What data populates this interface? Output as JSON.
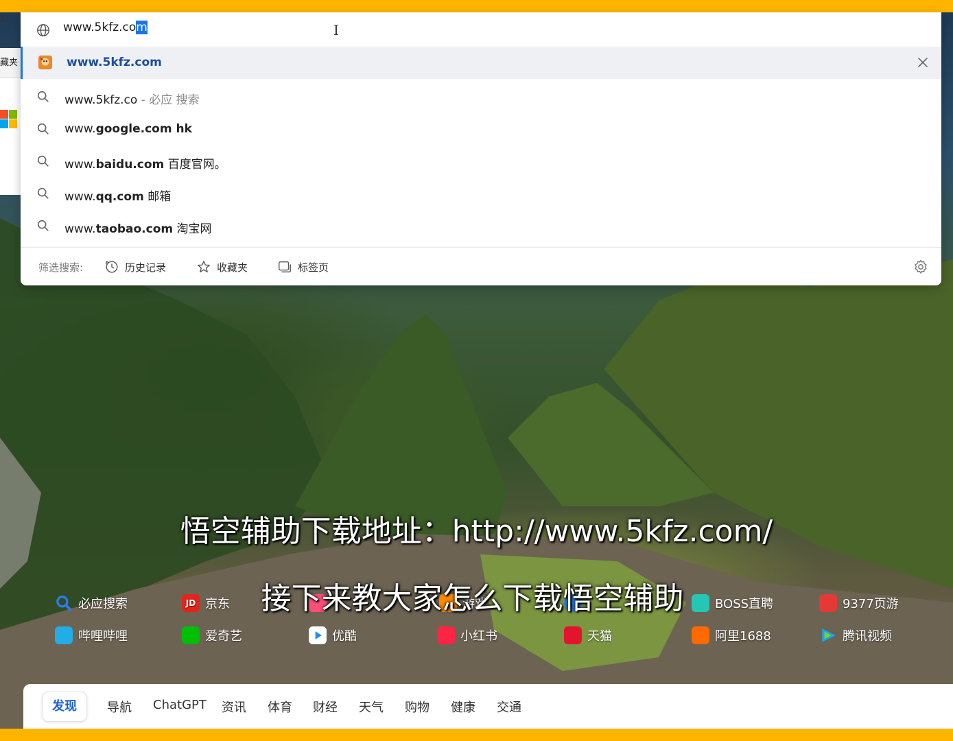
{
  "omnibox": {
    "input_value_prefix": "www.5kfz.co",
    "input_value_selected": "m"
  },
  "suggestions": [
    {
      "prefix": "",
      "bold": "www.5kfz.com",
      "suffix": "",
      "type": "site"
    },
    {
      "prefix": "www.5kfz.co",
      "bold": "",
      "suffix": " - 必应 搜索",
      "type": "search"
    },
    {
      "prefix": "www.",
      "bold": "google.com hk",
      "suffix": "",
      "type": "search"
    },
    {
      "prefix": "www.",
      "bold": "baidu.com",
      "suffix": " 百度官网。",
      "type": "search"
    },
    {
      "prefix": "www.",
      "bold": "qq.com",
      "suffix": " 邮箱",
      "type": "search"
    },
    {
      "prefix": "www.",
      "bold": "taobao.com",
      "suffix": " 淘宝网",
      "type": "search"
    }
  ],
  "filter": {
    "label": "筛选搜索:",
    "history": "历史记录",
    "favorites": "收藏夹",
    "tabs": "标签页"
  },
  "left_chrome": {
    "bookmark_label": "藏夹"
  },
  "quick_links_row1": [
    {
      "label": "必应搜索",
      "icon": "search-icon",
      "color": "#2b7bf6"
    },
    {
      "label": "京东",
      "icon": "JD",
      "color": "#e1251b"
    },
    {
      "label": "",
      "icon": "pink-app-icon",
      "color": "#ff4f7a"
    },
    {
      "label": "游戏",
      "icon": "game-icon",
      "color": "#ff8a00"
    },
    {
      "label": "",
      "icon": "blue-app-icon",
      "color": "#2f80ed"
    },
    {
      "label": "BOSS直聘",
      "icon": "boss-icon",
      "color": "#25c6b4"
    },
    {
      "label": "9377页游",
      "icon": "9377-icon",
      "color": "#e53935"
    }
  ],
  "quick_links_row2": [
    {
      "label": "哔哩哔哩",
      "icon": "bilibili-icon",
      "color": "#23ade5"
    },
    {
      "label": "爱奇艺",
      "icon": "iqiyi-icon",
      "color": "#00be06"
    },
    {
      "label": "优酷",
      "icon": "youku-icon",
      "color": "#1f8ef1"
    },
    {
      "label": "小红书",
      "icon": "xiaohongshu-icon",
      "color": "#ff2442"
    },
    {
      "label": "天猫",
      "icon": "tmall-icon",
      "color": "#e3152d"
    },
    {
      "label": "阿里1688",
      "icon": "1688-icon",
      "color": "#ff6a00"
    },
    {
      "label": "腾讯视频",
      "icon": "tencent-video-icon",
      "color": "#13a9f2"
    }
  ],
  "captions": {
    "line1": "悟空辅助下载地址：http://www.5kfz.com/",
    "line2": "接下来教大家怎么下载悟空辅助"
  },
  "feed_tabs": [
    "发现",
    "导航",
    "ChatGPT",
    "资讯",
    "体育",
    "财经",
    "天气",
    "购物",
    "健康",
    "交通"
  ]
}
